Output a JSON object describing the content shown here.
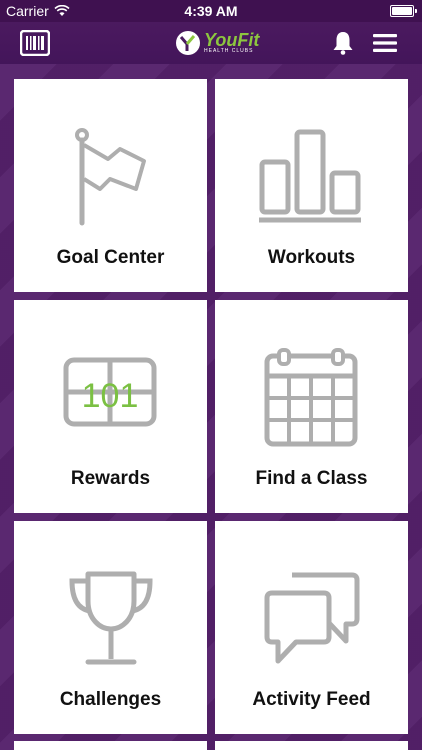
{
  "status_bar": {
    "carrier": "Carrier",
    "time": "4:39 AM"
  },
  "nav": {
    "logo_text": "YouFit",
    "logo_sub": "HEALTH CLUBS"
  },
  "tiles": [
    {
      "label": "Goal Center",
      "icon": "flag-icon"
    },
    {
      "label": "Workouts",
      "icon": "bar-chart-icon"
    },
    {
      "label": "Rewards",
      "icon": "rewards-card-icon",
      "icon_text": "101"
    },
    {
      "label": "Find a Class",
      "icon": "calendar-icon"
    },
    {
      "label": "Challenges",
      "icon": "trophy-icon"
    },
    {
      "label": "Activity Feed",
      "icon": "chat-bubbles-icon"
    }
  ],
  "colors": {
    "brand_purple": "#4a1b5e",
    "logo_green": "#8dc63f",
    "icon_gray": "#aeaeae"
  }
}
